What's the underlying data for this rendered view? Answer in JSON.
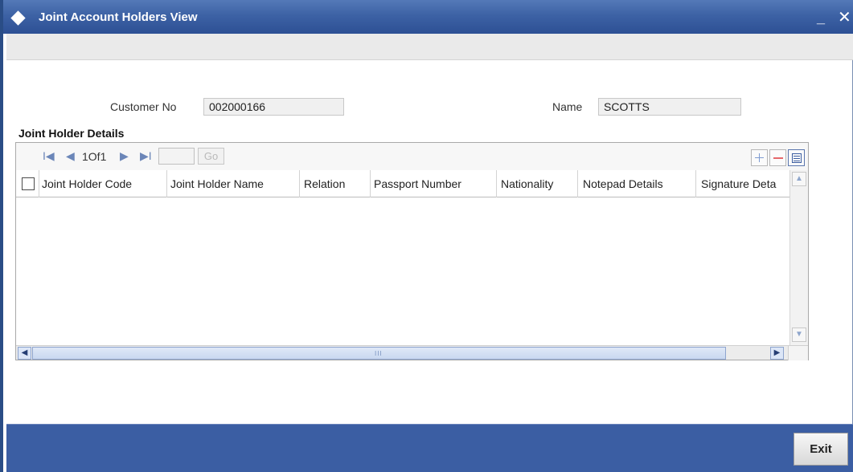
{
  "window": {
    "title": "Joint Account Holders View",
    "minimize_label": "_",
    "close_label": "✕"
  },
  "form": {
    "customer_no_label": "Customer No",
    "customer_no_value": "002000166",
    "name_label": "Name",
    "name_value": "SCOTTS"
  },
  "section": {
    "title": "Joint Holder Details"
  },
  "pager": {
    "first_label": "I◀",
    "prev_label": "◀",
    "page_info": "1Of1",
    "next_label": "▶",
    "last_label": "▶I",
    "go_label": "Go",
    "page_input_value": ""
  },
  "grid": {
    "columns": [
      "Joint Holder Code",
      "Joint Holder Name",
      "Relation",
      "Passport Number",
      "Nationality",
      "Notepad Details",
      "Signature Deta"
    ],
    "rows": [],
    "scrollbar_grip": "III"
  },
  "footer": {
    "exit_label": "Exit"
  },
  "colors": {
    "title_bar": "#3d62a5",
    "footer": "#3b5ea3",
    "accent_blue": "#2a4d86"
  }
}
